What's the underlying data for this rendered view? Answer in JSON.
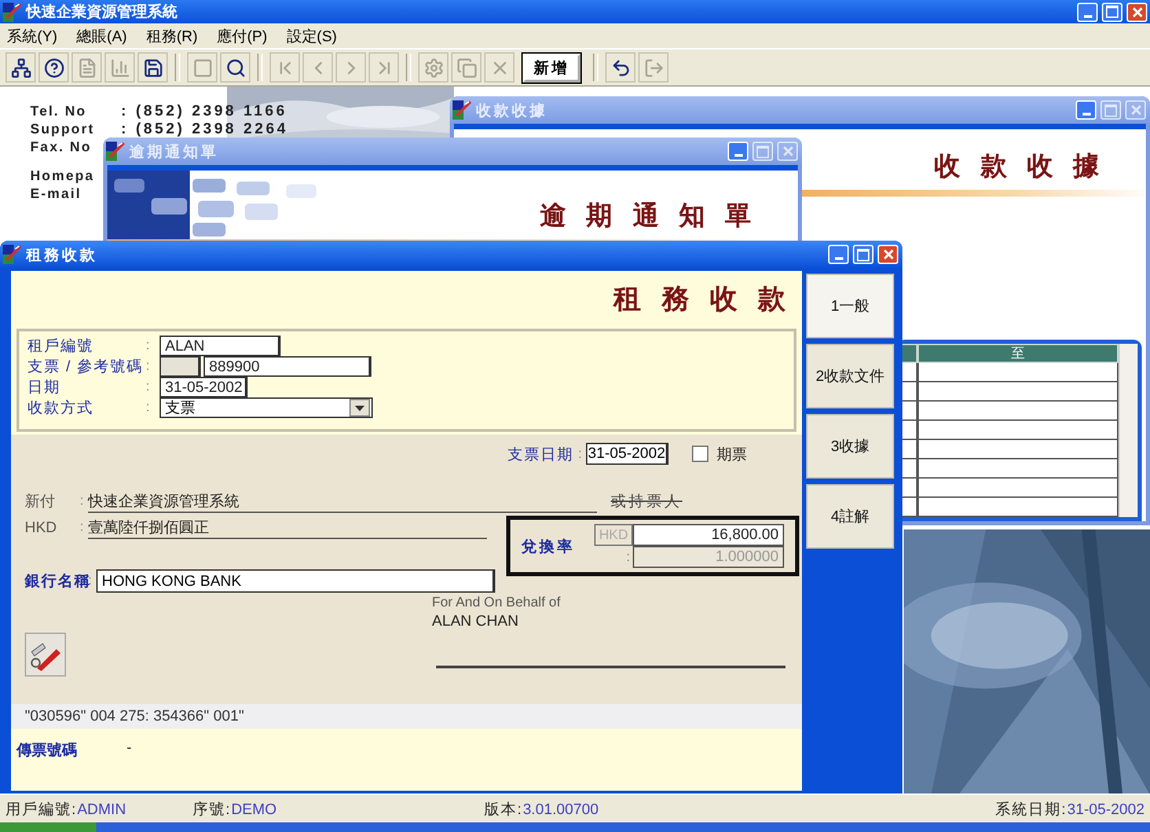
{
  "app": {
    "title": "快速企業資源管理系統"
  },
  "menu": [
    "系統(Y)",
    "總賬(A)",
    "租務(R)",
    "應付(P)",
    "設定(S)"
  ],
  "toolbar": [
    {
      "kind": "icon",
      "disabled": false
    },
    {
      "kind": "icon",
      "disabled": false
    },
    {
      "kind": "icon",
      "disabled": true
    },
    {
      "kind": "icon",
      "disabled": true
    },
    {
      "kind": "icon",
      "disabled": false
    },
    {
      "kind": "separator"
    },
    {
      "kind": "icon",
      "disabled": true
    },
    {
      "kind": "icon",
      "disabled": false
    },
    {
      "kind": "separator"
    },
    {
      "kind": "icon",
      "disabled": true
    },
    {
      "kind": "icon",
      "disabled": true
    },
    {
      "kind": "icon",
      "disabled": true
    },
    {
      "kind": "icon",
      "disabled": true
    },
    {
      "kind": "separator"
    },
    {
      "kind": "icon",
      "disabled": true
    },
    {
      "kind": "icon",
      "disabled": true
    },
    {
      "kind": "icon",
      "disabled": true
    },
    {
      "kind": "text",
      "label": "新增",
      "disabled": false
    },
    {
      "kind": "separator"
    },
    {
      "kind": "icon",
      "disabled": false
    },
    {
      "kind": "icon",
      "disabled": true
    }
  ],
  "background": {
    "contacts": [
      {
        "label": "Tel. No",
        "value": ": (852) 2398 1166"
      },
      {
        "label": "Support",
        "value": ": (852) 2398 2264"
      },
      {
        "label": "Fax. No"
      },
      {
        "label": "Homepa"
      },
      {
        "label": "E-mail"
      }
    ]
  },
  "receipt_window": {
    "title": "收款收據",
    "active": false,
    "heading": "收 款 收 據",
    "grid": {
      "columns": [
        "至"
      ]
    }
  },
  "notice_window": {
    "title": "逾期通知單",
    "active": false,
    "heading": "逾 期 通 知 單"
  },
  "rent_window": {
    "title": "租務收款",
    "active": true,
    "heading": "租 務 收 款",
    "fields": [
      {
        "kind": "text",
        "label": "租戶編號",
        "sep": ":",
        "value": "ALAN"
      },
      {
        "kind": "split",
        "label": "支票 / 參考號碼",
        "sep": ":",
        "value": "889900"
      },
      {
        "kind": "date",
        "label": "日期",
        "sep": ":",
        "value": "31-05-2002"
      },
      {
        "kind": "select",
        "label": "收款方式",
        "sep": ":",
        "value": "支票"
      }
    ],
    "cheque": {
      "date_label": "支票日期",
      "date_sep": ":",
      "date": "31-05-2002",
      "post_dated": {
        "label": "期票",
        "checked": false
      },
      "pay_label": "新付",
      "pay_sep": ":",
      "payee": "快速企業資源管理系統",
      "bearer": "或持票人",
      "currency": "HKD",
      "currency_sep": ":",
      "amount_words": "壹萬陸仟捌佰圓正",
      "exchange": {
        "label": "兌換率",
        "currency": "HKD",
        "sep": ":",
        "amount": "16,800.00",
        "rate": "1.000000"
      },
      "bank_label": "銀行名稱",
      "bank_sep": ":",
      "bank": "HONG KONG BANK",
      "behalf": "For And On Behalf of",
      "signer": "ALAN CHAN"
    },
    "micr": "\"030596\" 004 275: 354366\" 001\"",
    "voucher": {
      "label": "傳票號碼",
      "value": "-"
    },
    "tabs": [
      {
        "label": "1一般",
        "selected": true
      },
      {
        "label": "2收款文件",
        "selected": false
      },
      {
        "label": "3收據",
        "selected": false
      },
      {
        "label": "4註解",
        "selected": false
      }
    ]
  },
  "status_bar": [
    {
      "label": "用戶編號:",
      "value": "ADMIN"
    },
    {
      "label": "序號:",
      "value": "DEMO"
    },
    {
      "label": "版本:",
      "value": "3.01.00700"
    },
    {
      "label": "系統日期:",
      "value": "31-05-2002"
    }
  ]
}
